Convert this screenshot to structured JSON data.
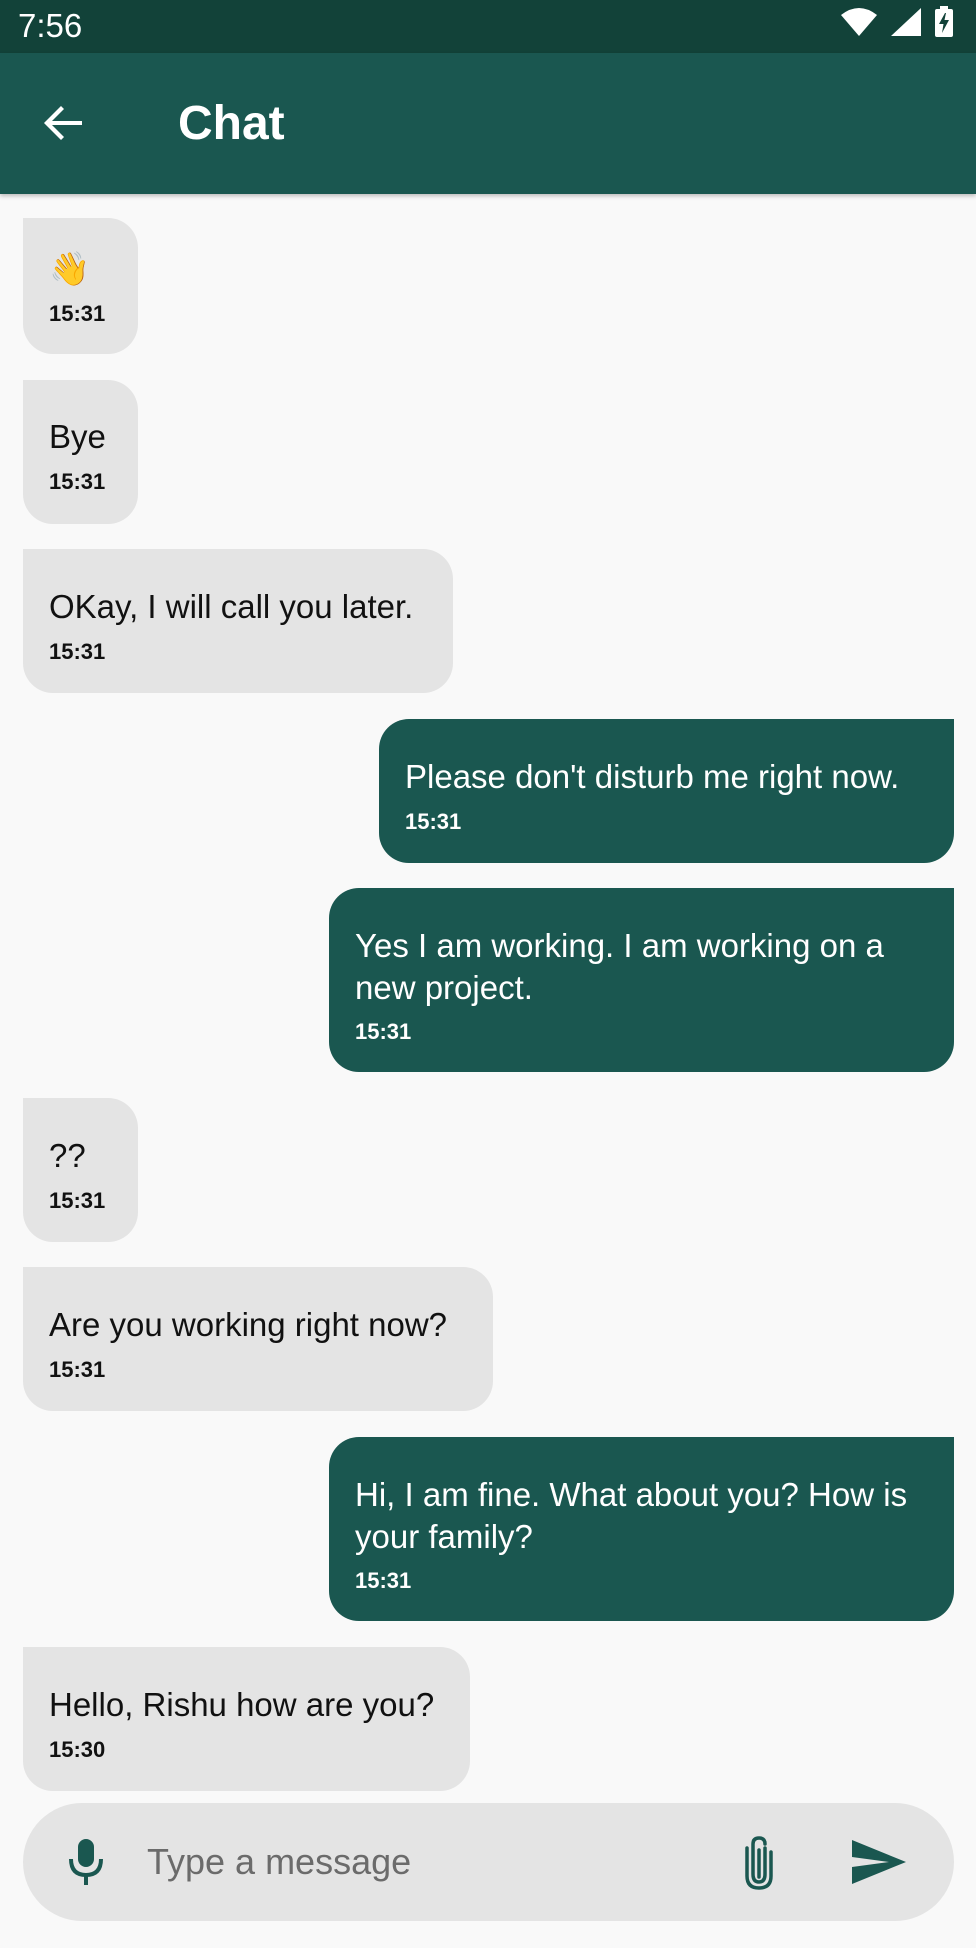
{
  "status_bar": {
    "time": "7:56",
    "icons": [
      "wifi-icon",
      "signal-icon",
      "battery-charging-icon"
    ]
  },
  "app_bar": {
    "title": "Chat",
    "back_icon": "arrow-left-icon",
    "background_color": "#1a5750"
  },
  "colors": {
    "status_bar": "#124239",
    "outgoing_bubble": "#1a5750",
    "incoming_bubble": "#e4e4e4",
    "background": "#f9f9f9"
  },
  "messages": [
    {
      "direction": "incoming",
      "text": "👋",
      "time": "15:31"
    },
    {
      "direction": "incoming",
      "text": "Bye",
      "time": "15:31"
    },
    {
      "direction": "incoming",
      "text": "OKay, I will call you later.",
      "time": "15:31"
    },
    {
      "direction": "outgoing",
      "text": "Please don't disturb me right now.",
      "time": "15:31"
    },
    {
      "direction": "outgoing",
      "text": "Yes I am working. I am working on a new project.",
      "time": "15:31"
    },
    {
      "direction": "incoming",
      "text": "??",
      "time": "15:31"
    },
    {
      "direction": "incoming",
      "text": "Are you working right now?",
      "time": "15:31"
    },
    {
      "direction": "outgoing",
      "text": "Hi, I am fine. What about you? How is your family?",
      "time": "15:31"
    },
    {
      "direction": "incoming",
      "text": "Hello, Rishu how are you?",
      "time": "15:30"
    }
  ],
  "composer": {
    "placeholder": "Type a message",
    "value": "",
    "mic_icon": "microphone-icon",
    "attach_icon": "paperclip-icon",
    "send_icon": "send-icon"
  }
}
